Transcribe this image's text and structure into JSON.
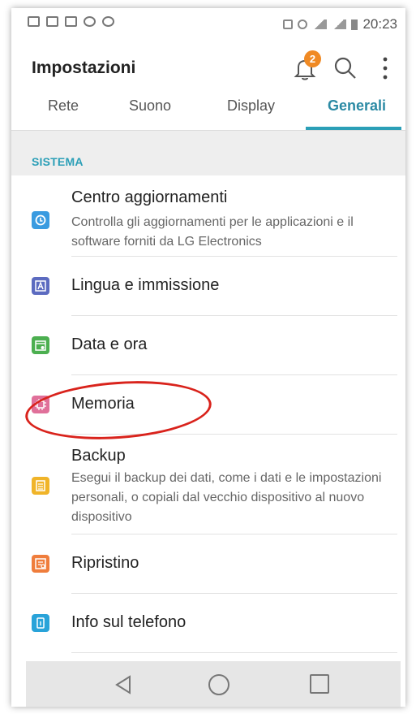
{
  "status_bar": {
    "time": "20:23"
  },
  "app_bar": {
    "title": "Impostazioni",
    "notification_count": "2"
  },
  "tabs": [
    {
      "label": "Rete"
    },
    {
      "label": "Suono"
    },
    {
      "label": "Display"
    },
    {
      "label": "Generali",
      "active": true
    }
  ],
  "section": {
    "label": "SISTEMA"
  },
  "items": [
    {
      "label": "Centro aggiornamenti",
      "desc": "Controlla gli aggiornamenti per le applicazioni e il software forniti da LG Electronics",
      "icon": "update-icon",
      "color": "#3a9be0"
    },
    {
      "label": "Lingua e immissione",
      "desc": "",
      "icon": "language-icon",
      "color": "#5c6bc0"
    },
    {
      "label": "Data e ora",
      "desc": "",
      "icon": "calendar-icon",
      "color": "#4caf50"
    },
    {
      "label": "Memoria",
      "desc": "",
      "icon": "chip-icon",
      "color": "#e0709a"
    },
    {
      "label": "Backup",
      "desc": "Esegui il backup dei dati, come i dati e le impostazioni personali, o copiali dal vecchio dispositivo al nuovo dispositivo",
      "icon": "backup-icon",
      "color": "#f0b429"
    },
    {
      "label": "Ripristino",
      "desc": "",
      "icon": "reset-icon",
      "color": "#ef7d3c"
    },
    {
      "label": "Info sul telefono",
      "desc": "",
      "icon": "phone-info-icon",
      "color": "#29a3d9"
    }
  ],
  "colors": {
    "accent": "#2b9fb7",
    "annotation": "#d9231c",
    "badge": "#f08a24"
  }
}
